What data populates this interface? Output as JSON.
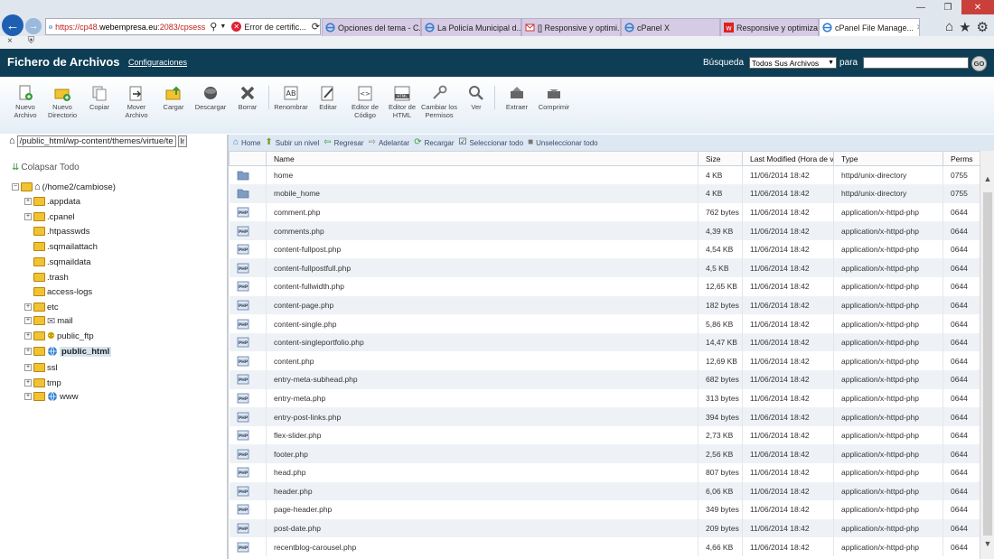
{
  "browser": {
    "url_part1": "https://cp48.",
    "url_part2": "webempresa.eu",
    "url_part3": ":2083/cpsess",
    "cert_error": "Error de certific...",
    "tabs": [
      {
        "label": "Opciones del tema - C...",
        "icon": "ie-icon",
        "active": false,
        "width": 110
      },
      {
        "label": "La Policía Municipal d...",
        "icon": "ie-icon",
        "active": false,
        "width": 111
      },
      {
        "label": "[] Responsive y optimi...",
        "icon": "gmail-icon",
        "active": false,
        "width": 110
      },
      {
        "label": "cPanel X",
        "icon": "ie-icon",
        "active": false,
        "width": 110
      },
      {
        "label": "Responsive y optimiza...",
        "icon": "w-icon",
        "active": false,
        "width": 109
      },
      {
        "label": "cPanel File Manage...",
        "icon": "ie-icon",
        "active": true,
        "width": 112
      }
    ]
  },
  "header": {
    "title": "Fichero de Archivos",
    "config_link": "Configuraciones",
    "search_label": "Búsqueda",
    "search_scope": "Todos Sus Archivos",
    "search_for": "para",
    "go_label": "GO"
  },
  "toolbar": [
    {
      "label": "Nuevo Archivo",
      "name": "new-file-button",
      "icon": "new-file-icon"
    },
    {
      "label": "Nuevo Directorio",
      "name": "new-folder-button",
      "icon": "new-folder-icon"
    },
    {
      "label": "Copiar",
      "name": "copy-button",
      "icon": "copy-icon"
    },
    {
      "label": "Mover Archivo",
      "name": "move-button",
      "icon": "move-icon"
    },
    {
      "label": "Cargar",
      "name": "upload-button",
      "icon": "upload-icon"
    },
    {
      "label": "Descargar",
      "name": "download-button",
      "icon": "download-icon"
    },
    {
      "label": "Borrar",
      "name": "delete-button",
      "icon": "delete-icon"
    },
    {
      "label": "Renombrar",
      "name": "rename-button",
      "icon": "rename-icon"
    },
    {
      "label": "Editar",
      "name": "edit-button",
      "icon": "edit-icon"
    },
    {
      "label": "Editor de Código",
      "name": "code-editor-button",
      "icon": "code-editor-icon"
    },
    {
      "label": "Editor de HTML",
      "name": "html-editor-button",
      "icon": "html-editor-icon"
    },
    {
      "label": "Cambiar los Permisos",
      "name": "permissions-button",
      "icon": "permissions-icon"
    },
    {
      "label": "Ver",
      "name": "view-button",
      "icon": "view-icon"
    },
    {
      "label": "Extraer",
      "name": "extract-button",
      "icon": "extract-icon"
    },
    {
      "label": "Comprimir",
      "name": "compress-button",
      "icon": "compress-icon"
    }
  ],
  "left": {
    "path": "/public_html/wp-content/themes/virtue/te",
    "go": "Ir",
    "collapse_label": "Colapsar Todo",
    "root": "(/home2/cambiose)",
    "tree": [
      {
        "label": ".appdata",
        "expander": true,
        "icon": "folder"
      },
      {
        "label": ".cpanel",
        "expander": true,
        "icon": "folder"
      },
      {
        "label": ".htpasswds",
        "expander": false,
        "icon": "folder"
      },
      {
        "label": ".sqmailattach",
        "expander": false,
        "icon": "folder"
      },
      {
        "label": ".sqmaildata",
        "expander": false,
        "icon": "folder"
      },
      {
        "label": ".trash",
        "expander": false,
        "icon": "folder"
      },
      {
        "label": "access-logs",
        "expander": false,
        "icon": "folder"
      },
      {
        "label": "etc",
        "expander": true,
        "icon": "folder"
      },
      {
        "label": "mail",
        "expander": true,
        "icon": "mail"
      },
      {
        "label": "public_ftp",
        "expander": true,
        "icon": "ftp"
      },
      {
        "label": "public_html",
        "expander": true,
        "icon": "globe",
        "selected": true
      },
      {
        "label": "ssl",
        "expander": true,
        "icon": "folder"
      },
      {
        "label": "tmp",
        "expander": true,
        "icon": "folder"
      },
      {
        "label": "www",
        "expander": true,
        "icon": "globe"
      }
    ]
  },
  "filenav": [
    {
      "label": "Home",
      "name": "home-nav-button",
      "glyph": "⌂",
      "color": "#4a7fb8"
    },
    {
      "label": "Subir un nivel",
      "name": "up-level-button",
      "glyph": "⬆",
      "color": "#7a9a2a"
    },
    {
      "label": "Regresar",
      "name": "back-button",
      "glyph": "⇦",
      "color": "#3a9a3a"
    },
    {
      "label": "Adelantar",
      "name": "forward-button",
      "glyph": "⇨",
      "color": "#888"
    },
    {
      "label": "Recargar",
      "name": "reload-button",
      "glyph": "⟳",
      "color": "#3a9a3a"
    },
    {
      "label": "Seleccionar todo",
      "name": "select-all-button",
      "glyph": "☑",
      "color": "#333"
    },
    {
      "label": "Unseleccionar todo",
      "name": "unselect-all-button",
      "glyph": "■",
      "color": "#777"
    }
  ],
  "table": {
    "columns": [
      "",
      "Name",
      "Size",
      "Last Modified (Hora de v",
      "Type",
      "Perms"
    ],
    "rows": [
      {
        "name": "home",
        "size": "4 KB",
        "modified": "11/06/2014 18:42",
        "type": "httpd/unix-directory",
        "perms": "0755",
        "icon": "folder"
      },
      {
        "name": "mobile_home",
        "size": "4 KB",
        "modified": "11/06/2014 18:42",
        "type": "httpd/unix-directory",
        "perms": "0755",
        "icon": "folder"
      },
      {
        "name": "comment.php",
        "size": "762 bytes",
        "modified": "11/06/2014 18:42",
        "type": "application/x-httpd-php",
        "perms": "0644",
        "icon": "php"
      },
      {
        "name": "comments.php",
        "size": "4,39 KB",
        "modified": "11/06/2014 18:42",
        "type": "application/x-httpd-php",
        "perms": "0644",
        "icon": "php"
      },
      {
        "name": "content-fullpost.php",
        "size": "4,54 KB",
        "modified": "11/06/2014 18:42",
        "type": "application/x-httpd-php",
        "perms": "0644",
        "icon": "php"
      },
      {
        "name": "content-fullpostfull.php",
        "size": "4,5 KB",
        "modified": "11/06/2014 18:42",
        "type": "application/x-httpd-php",
        "perms": "0644",
        "icon": "php"
      },
      {
        "name": "content-fullwidth.php",
        "size": "12,65 KB",
        "modified": "11/06/2014 18:42",
        "type": "application/x-httpd-php",
        "perms": "0644",
        "icon": "php"
      },
      {
        "name": "content-page.php",
        "size": "182 bytes",
        "modified": "11/06/2014 18:42",
        "type": "application/x-httpd-php",
        "perms": "0644",
        "icon": "php"
      },
      {
        "name": "content-single.php",
        "size": "5,86 KB",
        "modified": "11/06/2014 18:42",
        "type": "application/x-httpd-php",
        "perms": "0644",
        "icon": "php"
      },
      {
        "name": "content-singleportfolio.php",
        "size": "14,47 KB",
        "modified": "11/06/2014 18:42",
        "type": "application/x-httpd-php",
        "perms": "0644",
        "icon": "php"
      },
      {
        "name": "content.php",
        "size": "12,69 KB",
        "modified": "11/06/2014 18:42",
        "type": "application/x-httpd-php",
        "perms": "0644",
        "icon": "php"
      },
      {
        "name": "entry-meta-subhead.php",
        "size": "682 bytes",
        "modified": "11/06/2014 18:42",
        "type": "application/x-httpd-php",
        "perms": "0644",
        "icon": "php"
      },
      {
        "name": "entry-meta.php",
        "size": "313 bytes",
        "modified": "11/06/2014 18:42",
        "type": "application/x-httpd-php",
        "perms": "0644",
        "icon": "php"
      },
      {
        "name": "entry-post-links.php",
        "size": "394 bytes",
        "modified": "11/06/2014 18:42",
        "type": "application/x-httpd-php",
        "perms": "0644",
        "icon": "php"
      },
      {
        "name": "flex-slider.php",
        "size": "2,73 KB",
        "modified": "11/06/2014 18:42",
        "type": "application/x-httpd-php",
        "perms": "0644",
        "icon": "php"
      },
      {
        "name": "footer.php",
        "size": "2,56 KB",
        "modified": "11/06/2014 18:42",
        "type": "application/x-httpd-php",
        "perms": "0644",
        "icon": "php"
      },
      {
        "name": "head.php",
        "size": "807 bytes",
        "modified": "11/06/2014 18:42",
        "type": "application/x-httpd-php",
        "perms": "0644",
        "icon": "php"
      },
      {
        "name": "header.php",
        "size": "6,06 KB",
        "modified": "11/06/2014 18:42",
        "type": "application/x-httpd-php",
        "perms": "0644",
        "icon": "php"
      },
      {
        "name": "page-header.php",
        "size": "349 bytes",
        "modified": "11/06/2014 18:42",
        "type": "application/x-httpd-php",
        "perms": "0644",
        "icon": "php"
      },
      {
        "name": "post-date.php",
        "size": "209 bytes",
        "modified": "11/06/2014 18:42",
        "type": "application/x-httpd-php",
        "perms": "0644",
        "icon": "php"
      },
      {
        "name": "recentblog-carousel.php",
        "size": "4,66 KB",
        "modified": "11/06/2014 18:42",
        "type": "application/x-httpd-php",
        "perms": "0644",
        "icon": "php"
      }
    ]
  }
}
